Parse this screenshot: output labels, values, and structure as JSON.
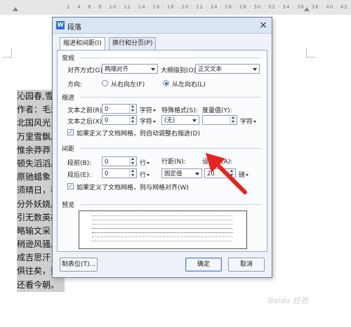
{
  "ruler": {
    "numbers": "2 · 4 · 6 · 8 · 10 · 12 · 14 · 16 · 18 · 20 · 22 · 24 · 26 · 28 · 30 · 32 · 34 · 36 · 38 · 40 · 42"
  },
  "document": {
    "lines": [
      "沁园春,雪",
      "作者：毛泽",
      "北国风光，",
      "万里雪飘。",
      "惟余莽莽，",
      "顿失滔滔。",
      "原驰蜡象，",
      "须晴日，看",
      "分外妖娆。",
      "引无数英雄",
      "略输文采，",
      "稍逊风骚。",
      "成吉思汗，",
      "俱往矣，数",
      "还看今朝。"
    ]
  },
  "dialog": {
    "title": "段落",
    "app_icon": "W",
    "tabs": [
      "缩进和间距(I)",
      "换行和分页(P)"
    ],
    "general": {
      "header": "常规",
      "align_label": "对齐方式(G):",
      "align_value": "两端对齐",
      "outline_label": "大纲级别(O):",
      "outline_value": "正文文本",
      "direction_label": "方向:",
      "rtl_label": "从右向左(F)",
      "ltr_label": "从左向右(L)"
    },
    "indent": {
      "header": "缩进",
      "before_label": "文本之前(R):",
      "before_value": "0",
      "before_unit": "字符",
      "special_label": "特殊格式(S):",
      "special_value": "(无)",
      "measure_label": "度量值(Y):",
      "measure_value": "",
      "measure_unit": "字符",
      "after_label": "文本之后(X):",
      "after_value": "0",
      "after_unit": "字符",
      "grid_check_label": "如果定义了文档网格，则自动调整右缩进(D)"
    },
    "spacing": {
      "header": "间距",
      "before_label": "段前(B):",
      "before_value": "0",
      "before_unit": "行",
      "line_label": "行距(N):",
      "line_value": "固定值",
      "set_label": "设置值(A):",
      "set_value": "20",
      "set_unit": "磅",
      "after_label": "段后(E):",
      "after_value": "0",
      "after_unit": "行",
      "grid_check_label": "如果定义了文档网格，则与网格对齐(W)"
    },
    "preview": {
      "header": "预览"
    },
    "buttons": {
      "tabs": "制表位(T)...",
      "ok": "确定",
      "cancel": "取消"
    }
  },
  "colors": {
    "accent_arrow": "#e8231f",
    "selection": "#cfcfcf"
  },
  "icons": [
    "close-icon",
    "app-icon",
    "dropdown-arrow-icon",
    "spinner-up-icon",
    "spinner-down-icon",
    "red-arrow-icon"
  ]
}
